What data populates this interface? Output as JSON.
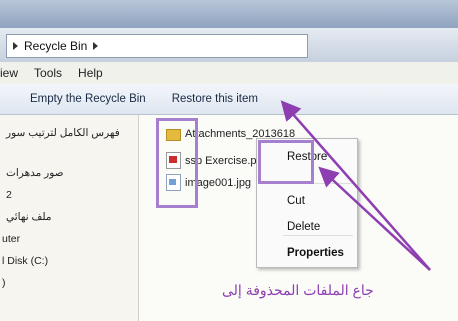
{
  "address": {
    "path": "Recycle Bin"
  },
  "menu": {
    "items": [
      "iew",
      "Tools",
      "Help"
    ]
  },
  "commands": {
    "empty": "Empty the Recycle Bin",
    "restore": "Restore this item"
  },
  "nav": {
    "items": [
      {
        "label": "فهرس الكامل لترتيب سور"
      },
      {
        "label": "صور مدهرات"
      },
      {
        "label": "2"
      },
      {
        "label": "ملف نهائي"
      },
      {
        "label": "uter"
      },
      {
        "label": "l Disk (C:)"
      },
      {
        "label": ")"
      }
    ]
  },
  "files": [
    {
      "name": "Attachments_2013618",
      "icon": "folder-icon"
    },
    {
      "name": "ssp Exercise.pdf",
      "icon": "pdf-icon"
    },
    {
      "name": "image001.jpg",
      "icon": "image-icon"
    }
  ],
  "context_menu": {
    "items": [
      "Restore",
      "Cut",
      "Delete",
      "Properties"
    ]
  },
  "annotation": {
    "text": "جاع الملفات المحذوفة إلى"
  },
  "colors": {
    "annotation": "#8d3fb1",
    "highlight": "#a77fcf"
  }
}
